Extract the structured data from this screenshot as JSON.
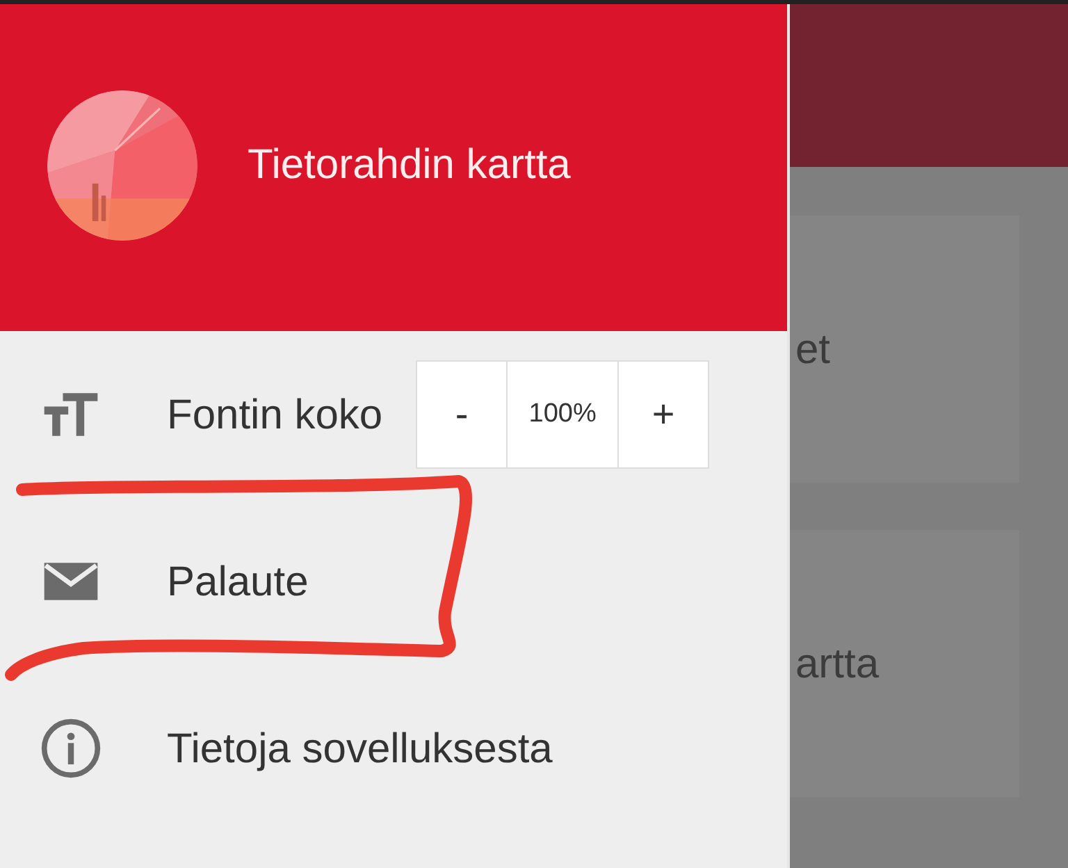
{
  "drawer": {
    "header": {
      "title": "Tietorahdin kartta"
    },
    "items": [
      {
        "kind": "stepper",
        "label": "Fontin koko",
        "stepper": {
          "decrease": "-",
          "value": "100%",
          "increase": "+"
        }
      },
      {
        "kind": "link",
        "label": "Palaute"
      },
      {
        "kind": "link",
        "label": "Tietoja sovelluksesta"
      }
    ]
  },
  "background": {
    "cards": [
      {
        "text": "et"
      },
      {
        "text": "artta"
      }
    ]
  }
}
